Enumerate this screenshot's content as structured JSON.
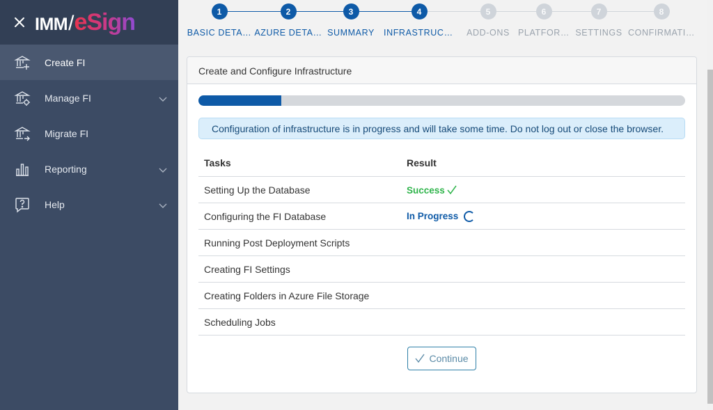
{
  "sidebar": {
    "logo": {
      "imm": "IMM",
      "slash": "/",
      "esign": "eSign"
    },
    "items": [
      {
        "label": "Create FI",
        "icon": "bank-plus-icon",
        "active": true
      },
      {
        "label": "Manage FI",
        "icon": "bank-gear-icon",
        "expandable": true
      },
      {
        "label": "Migrate FI",
        "icon": "bank-arrow-icon"
      },
      {
        "label": "Reporting",
        "icon": "bar-chart-icon",
        "expandable": true
      },
      {
        "label": "Help",
        "icon": "question-bubble-icon",
        "expandable": true
      }
    ]
  },
  "stepper": [
    {
      "num": "1",
      "label": "BASIC DETA…",
      "state": "done"
    },
    {
      "num": "2",
      "label": "AZURE DETA…",
      "state": "done"
    },
    {
      "num": "3",
      "label": "SUMMARY",
      "state": "done"
    },
    {
      "num": "4",
      "label": "INFRASTRUCT…",
      "state": "done"
    },
    {
      "num": "5",
      "label": "ADD-ONS",
      "state": "todo"
    },
    {
      "num": "6",
      "label": "PLATFOR…",
      "state": "todo"
    },
    {
      "num": "7",
      "label": "SETTINGS",
      "state": "todo"
    },
    {
      "num": "8",
      "label": "CONFIRMATI…",
      "state": "todo"
    }
  ],
  "card": {
    "title": "Create and Configure Infrastructure",
    "progress_fraction": 0.17,
    "info": "Configuration of infrastructure is in progress and will take some time. Do not log out or close the browser.",
    "columns": [
      "Tasks",
      "Result"
    ],
    "rows": [
      {
        "task": "Setting Up the Database",
        "result": "Success",
        "status": "success"
      },
      {
        "task": "Configuring the FI Database",
        "result": "In Progress",
        "status": "progress"
      },
      {
        "task": "Running Post Deployment Scripts",
        "result": "",
        "status": ""
      },
      {
        "task": "Creating FI Settings",
        "result": "",
        "status": ""
      },
      {
        "task": "Creating Folders in Azure File Storage",
        "result": "",
        "status": ""
      },
      {
        "task": "Scheduling Jobs",
        "result": "",
        "status": ""
      }
    ],
    "continue_label": "Continue"
  },
  "colors": {
    "primary": "#0e5aa7",
    "success": "#2fb44b",
    "sidebar": "#3c4b64"
  }
}
